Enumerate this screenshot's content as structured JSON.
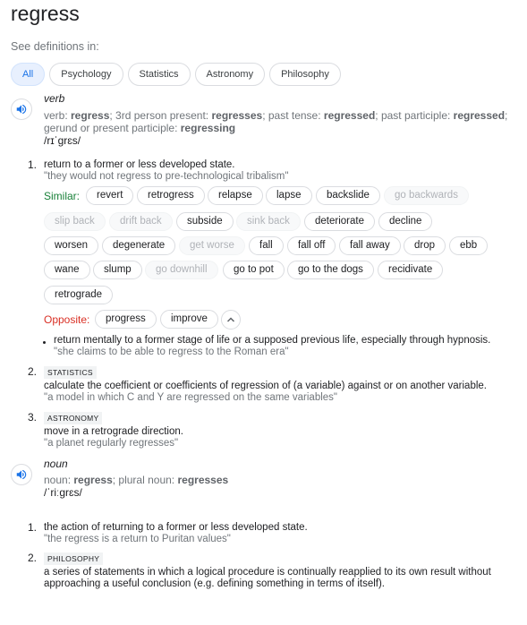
{
  "word": "regress",
  "see_definitions": "See definitions in:",
  "filters": [
    "All",
    "Psychology",
    "Statistics",
    "Astronomy",
    "Philosophy"
  ],
  "verb": {
    "pos": "verb",
    "forms_prefix": "verb: ",
    "form1": "regress",
    "t1": "; 3rd person present: ",
    "form2": "regresses",
    "t2": "; past tense: ",
    "form3": "regressed",
    "t3": "; past participle: ",
    "form4": "regressed",
    "t4": "; gerund or present participle: ",
    "form5": "regressing",
    "phonetic": "/rɪˈɡrɛs/",
    "senses": [
      {
        "num": "1.",
        "def": "return to a former or less developed state.",
        "example": "\"they would not regress to pre-technological tribalism\"",
        "similar_label": "Similar:",
        "synonyms": [
          "revert",
          "retrogress",
          "relapse",
          "lapse",
          "backslide",
          "go backwards",
          "slip back",
          "drift back",
          "subside",
          "sink back",
          "deteriorate",
          "decline",
          "worsen",
          "degenerate",
          "get worse",
          "fall",
          "fall off",
          "fall away",
          "drop",
          "ebb",
          "wane",
          "slump",
          "go downhill",
          "go to pot",
          "go to the dogs",
          "recidivate",
          "retrograde"
        ],
        "opposite_label": "Opposite:",
        "antonyms": [
          "progress",
          "improve"
        ],
        "sub_def": "return mentally to a former stage of life or a supposed previous life, especially through hypnosis.",
        "sub_example": "\"she claims to be able to regress to the Roman era\""
      },
      {
        "num": "2.",
        "label": "STATISTICS",
        "def": "calculate the coefficient or coefficients of regression of (a variable) against or on another variable.",
        "example": "\"a model in which C and Y are regressed on the same variables\""
      },
      {
        "num": "3.",
        "label": "ASTRONOMY",
        "def": "move in a retrograde direction.",
        "example": "\"a planet regularly regresses\""
      }
    ]
  },
  "noun": {
    "pos": "noun",
    "forms_prefix": "noun: ",
    "form1": "regress",
    "t1": "; plural noun: ",
    "form2": "regresses",
    "phonetic": "/ˈriːɡrɛs/",
    "senses": [
      {
        "num": "1.",
        "def": "the action of returning to a former or less developed state.",
        "example": "\"the regress is a return to Puritan values\""
      },
      {
        "num": "2.",
        "label": "PHILOSOPHY",
        "def": "a series of statements in which a logical procedure is continually reapplied to its own result without approaching a useful conclusion (e.g. defining something in terms of itself)."
      }
    ]
  },
  "colors": {
    "accent": "#1a73e8",
    "similar": "#188038",
    "opposite": "#d93025"
  }
}
